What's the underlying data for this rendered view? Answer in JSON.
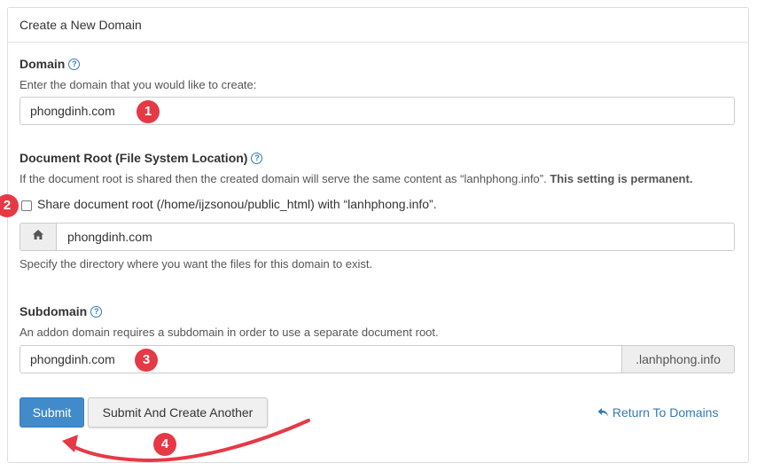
{
  "panel": {
    "title": "Create a New Domain"
  },
  "domain": {
    "label": "Domain",
    "help": "Enter the domain that you would like to create:",
    "value": "phongdinh.com",
    "badge": "1"
  },
  "docroot": {
    "label": "Document Root (File System Location)",
    "help_text": "If the document root is shared then the created domain will serve the same content as “lanhphong.info”.",
    "help_bold": "This setting is permanent.",
    "share_label": "Share document root (/home/ijzsonou/public_html) with “lanhphong.info”.",
    "share_checked": false,
    "share_badge": "2",
    "home_icon": "home-icon",
    "value": "phongdinh.com",
    "hint": "Specify the directory where you want the files for this domain to exist."
  },
  "subdomain": {
    "label": "Subdomain",
    "help": "An addon domain requires a subdomain in order to use a separate document root.",
    "value": "phongdinh.com",
    "suffix": ".lanhphong.info",
    "badge": "3"
  },
  "actions": {
    "submit_label": "Submit",
    "submit_another_label": "Submit And Create Another",
    "return_label": "Return To Domains",
    "return_icon": "return-arrow-icon",
    "badge": "4"
  },
  "colors": {
    "accent": "#428bca",
    "link": "#337ab7",
    "annotation": "#e63946"
  }
}
